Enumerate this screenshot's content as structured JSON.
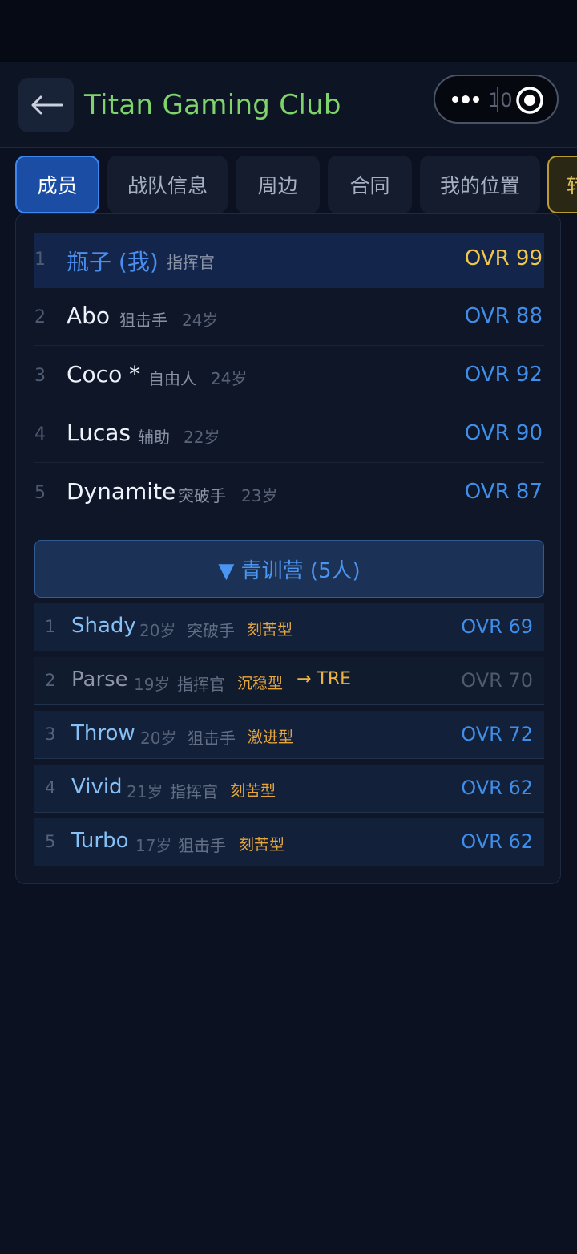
{
  "header": {
    "title": "Titan Gaming Club",
    "back_icon": "arrow-left-icon",
    "menu_icon": "more-dots-icon",
    "close_icon": "target-icon",
    "capsule_text": "10"
  },
  "tabs": [
    {
      "label": "成员",
      "active": true
    },
    {
      "label": "战队信息"
    },
    {
      "label": "周边"
    },
    {
      "label": "合同"
    },
    {
      "label": "我的位置"
    },
    {
      "label": "转"
    }
  ],
  "members": [
    {
      "index": "1",
      "name": "瓶子 (我)",
      "role": "指挥官",
      "age": "",
      "ovr": "OVR 99"
    },
    {
      "index": "2",
      "name": "Abo",
      "role": "狙击手",
      "age": "24岁",
      "ovr": "OVR 88"
    },
    {
      "index": "3",
      "name": "Coco *",
      "role": "自由人",
      "age": "24岁",
      "ovr": "OVR 92"
    },
    {
      "index": "4",
      "name": "Lucas",
      "role": "辅助",
      "age": "22岁",
      "ovr": "OVR 90"
    },
    {
      "index": "5",
      "name": "Dynamite",
      "role": "突破手",
      "age": "23岁",
      "ovr": "OVR 87"
    }
  ],
  "academy": {
    "title": "▼ 青训营 (5人)",
    "players": [
      {
        "index": "1",
        "name": "Shady",
        "age": "20岁",
        "role": "突破手",
        "trait": "刻苦型",
        "transfer": "",
        "ovr": "OVR 69"
      },
      {
        "index": "2",
        "name": "Parse",
        "age": "19岁",
        "role": "指挥官",
        "trait": "沉稳型",
        "transfer": "→ TRE",
        "ovr": "OVR 70"
      },
      {
        "index": "3",
        "name": "Throw",
        "age": "20岁",
        "role": "狙击手",
        "trait": "激进型",
        "transfer": "",
        "ovr": "OVR 72"
      },
      {
        "index": "4",
        "name": "Vivid",
        "age": "21岁",
        "role": "指挥官",
        "trait": "刻苦型",
        "transfer": "",
        "ovr": "OVR 62"
      },
      {
        "index": "5",
        "name": "Turbo",
        "age": "17岁",
        "role": "狙击手",
        "trait": "刻苦型",
        "transfer": "",
        "ovr": "OVR 62"
      }
    ]
  },
  "colors": {
    "accent_blue": "#3f8eea",
    "title_green": "#7ed46b",
    "gold": "#f2c84b",
    "trait_orange": "#e6a63f"
  }
}
